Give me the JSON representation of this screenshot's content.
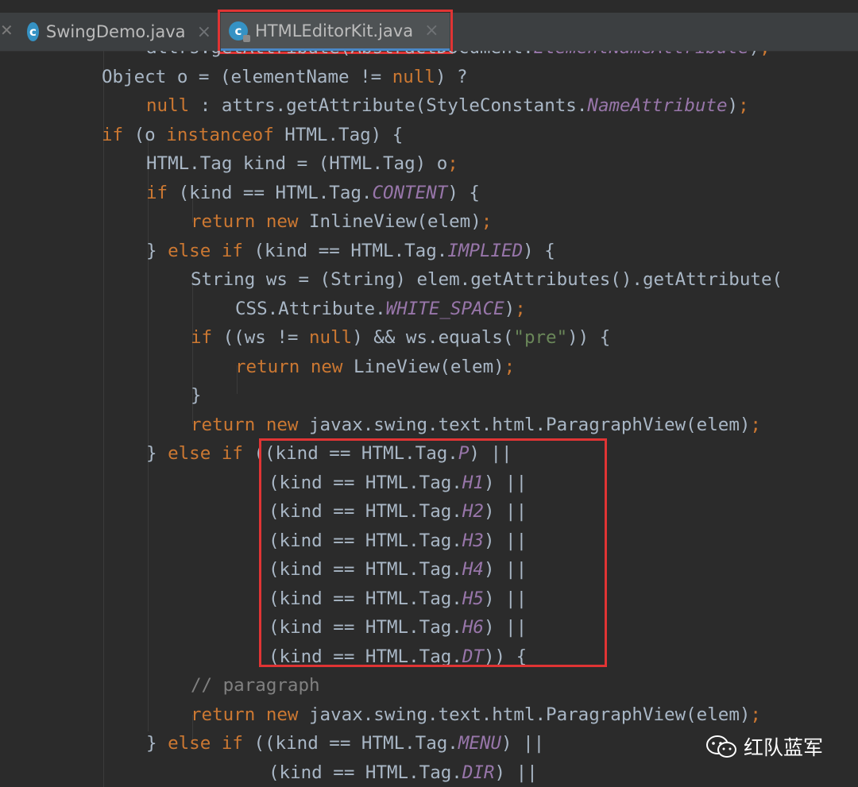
{
  "tabs": [
    {
      "label": "SwingDemo.java",
      "icon": "java-class-icon",
      "icon_letter": "c",
      "close": "×",
      "active": false
    },
    {
      "label": "HTMLEditorKit.java",
      "icon": "java-class-readonly-icon",
      "icon_letter": "c",
      "close": "×",
      "active": true
    }
  ],
  "code_lines": [
    [
      [
        "plain",
        "attrs.getAttribute(AbstractDocument."
      ],
      [
        "fld",
        "ElementNameAttribute"
      ],
      [
        "plain",
        ")"
      ],
      [
        "semi",
        ";"
      ]
    ],
    [
      [
        "plain",
        "Object o = (elementName != "
      ],
      [
        "kw",
        "null"
      ],
      [
        "plain",
        ") ?"
      ]
    ],
    [
      [
        "kw",
        "null"
      ],
      [
        "plain",
        " : attrs.getAttribute(StyleConstants."
      ],
      [
        "fld",
        "NameAttribute"
      ],
      [
        "plain",
        ")"
      ],
      [
        "semi",
        ";"
      ]
    ],
    [
      [
        "kw",
        "if"
      ],
      [
        "plain",
        " (o "
      ],
      [
        "kw",
        "instanceof"
      ],
      [
        "plain",
        " HTML.Tag) {"
      ]
    ],
    [
      [
        "plain",
        "HTML.Tag kind = (HTML.Tag) o"
      ],
      [
        "semi",
        ";"
      ]
    ],
    [
      [
        "kw",
        "if"
      ],
      [
        "plain",
        " (kind == HTML.Tag."
      ],
      [
        "fld",
        "CONTENT"
      ],
      [
        "plain",
        ") {"
      ]
    ],
    [
      [
        "kw",
        "return new"
      ],
      [
        "plain",
        " InlineView(elem)"
      ],
      [
        "semi",
        ";"
      ]
    ],
    [
      [
        "plain",
        "} "
      ],
      [
        "kw",
        "else if"
      ],
      [
        "plain",
        " (kind == HTML.Tag."
      ],
      [
        "fld",
        "IMPLIED"
      ],
      [
        "plain",
        ") {"
      ]
    ],
    [
      [
        "plain",
        "String ws = (String) elem.getAttributes().getAttribute("
      ]
    ],
    [
      [
        "plain",
        "CSS.Attribute."
      ],
      [
        "fld",
        "WHITE_SPACE"
      ],
      [
        "plain",
        ")"
      ],
      [
        "semi",
        ";"
      ]
    ],
    [
      [
        "kw",
        "if"
      ],
      [
        "plain",
        " ((ws != "
      ],
      [
        "kw",
        "null"
      ],
      [
        "plain",
        ") && ws.equals("
      ],
      [
        "str",
        "\"pre\""
      ],
      [
        "plain",
        ")) {"
      ]
    ],
    [
      [
        "kw",
        "return new"
      ],
      [
        "plain",
        " LineView(elem)"
      ],
      [
        "semi",
        ";"
      ]
    ],
    [
      [
        "plain",
        "}"
      ]
    ],
    [
      [
        "kw",
        "return new"
      ],
      [
        "plain",
        " javax.swing.text.html.ParagraphView(elem)"
      ],
      [
        "semi",
        ";"
      ]
    ],
    [
      [
        "plain",
        "} "
      ],
      [
        "kw",
        "else if"
      ],
      [
        "plain",
        " ((kind == HTML.Tag."
      ],
      [
        "fld",
        "P"
      ],
      [
        "plain",
        ") ||"
      ]
    ],
    [
      [
        "plain",
        "(kind == HTML.Tag."
      ],
      [
        "fld",
        "H1"
      ],
      [
        "plain",
        ") ||"
      ]
    ],
    [
      [
        "plain",
        "(kind == HTML.Tag."
      ],
      [
        "fld",
        "H2"
      ],
      [
        "plain",
        ") ||"
      ]
    ],
    [
      [
        "plain",
        "(kind == HTML.Tag."
      ],
      [
        "fld",
        "H3"
      ],
      [
        "plain",
        ") ||"
      ]
    ],
    [
      [
        "plain",
        "(kind == HTML.Tag."
      ],
      [
        "fld",
        "H4"
      ],
      [
        "plain",
        ") ||"
      ]
    ],
    [
      [
        "plain",
        "(kind == HTML.Tag."
      ],
      [
        "fld",
        "H5"
      ],
      [
        "plain",
        ") ||"
      ]
    ],
    [
      [
        "plain",
        "(kind == HTML.Tag."
      ],
      [
        "fld",
        "H6"
      ],
      [
        "plain",
        ") ||"
      ]
    ],
    [
      [
        "plain",
        "(kind == HTML.Tag."
      ],
      [
        "fld",
        "DT"
      ],
      [
        "plain",
        ")) {"
      ]
    ],
    [
      [
        "cmt",
        "// paragraph"
      ]
    ],
    [
      [
        "kw",
        "return new"
      ],
      [
        "plain",
        " javax.swing.text.html.ParagraphView(elem)"
      ],
      [
        "semi",
        ";"
      ]
    ],
    [
      [
        "plain",
        "} "
      ],
      [
        "kw",
        "else if"
      ],
      [
        "plain",
        " ((kind == HTML.Tag."
      ],
      [
        "fld",
        "MENU"
      ],
      [
        "plain",
        ") ||"
      ]
    ],
    [
      [
        "plain",
        "(kind == HTML.Tag."
      ],
      [
        "fld",
        "DIR"
      ],
      [
        "plain",
        ") ||"
      ]
    ]
  ],
  "watermark": {
    "text": "红队蓝军",
    "icon": "wechat-icon"
  },
  "colors": {
    "keyword": "#cc7832",
    "field": "#9876aa",
    "string": "#6a8759",
    "comment": "#808080",
    "text": "#a9b7c6",
    "highlight_box": "#e03434"
  }
}
